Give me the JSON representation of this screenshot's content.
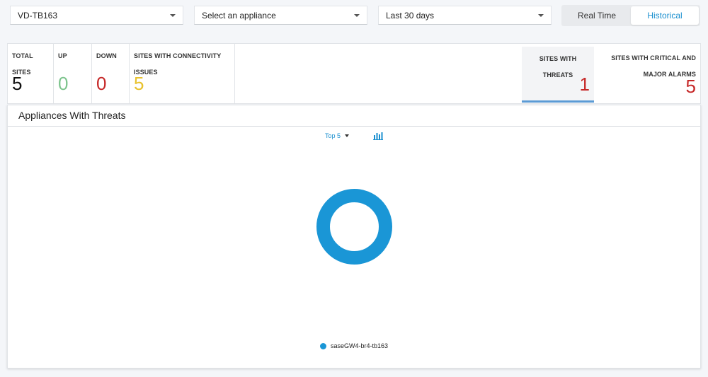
{
  "filters": {
    "tenant": "VD-TB163",
    "appliance_placeholder": "Select an appliance",
    "time_range": "Last 30 days"
  },
  "mode_toggle": {
    "options": [
      "Real Time",
      "Historical"
    ],
    "selected": "Historical"
  },
  "stats": {
    "total_sites": {
      "label": "TOTAL SITES",
      "value": "5",
      "color": "#111111"
    },
    "up": {
      "label": "UP",
      "value": "0",
      "color": "#7dc48d"
    },
    "down": {
      "label": "DOWN",
      "value": "0",
      "color": "#c62828"
    },
    "connectivity": {
      "label": "SITES WITH CONNECTIVITY ISSUES",
      "value": "5",
      "color": "#e8c22e"
    },
    "threats": {
      "label": "SITES WITH THREATS",
      "value": "1",
      "color": "#c62828"
    },
    "alarms": {
      "label": "SITES WITH CRITICAL AND MAJOR ALARMS",
      "value": "5",
      "color": "#c62828"
    }
  },
  "panel": {
    "title": "Appliances With Threats",
    "top_n_label": "Top 5"
  },
  "chart_data": {
    "type": "pie",
    "categories": [
      "saseGW4-br4-tb163"
    ],
    "values": [
      100
    ],
    "colors": [
      "#1a96d6"
    ],
    "title": "",
    "legend": "bottom"
  }
}
